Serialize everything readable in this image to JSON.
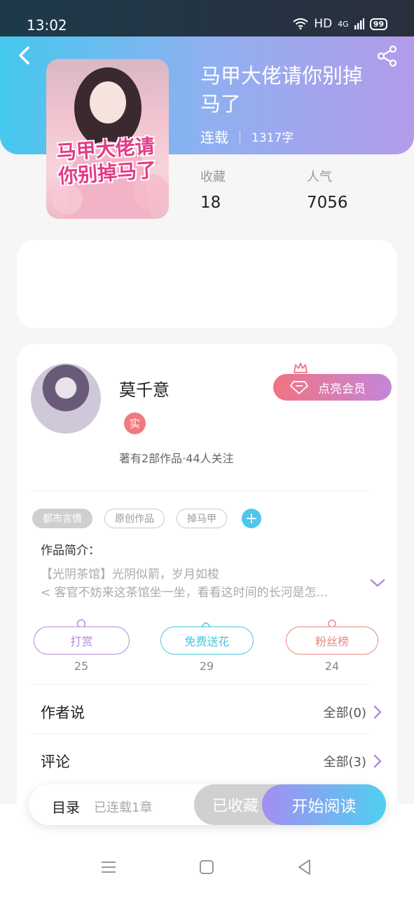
{
  "status_bar": {
    "time": "13:02",
    "network": "HD",
    "signal": "4G",
    "battery": "99"
  },
  "book": {
    "title": "马甲大佬请你别掉马了",
    "status": "连载",
    "words": "1317字",
    "cover_text": "马甲大佬请你别掉马了"
  },
  "stats": [
    {
      "label": "收藏",
      "value": "18"
    },
    {
      "label": "人气",
      "value": "7056"
    }
  ],
  "author": {
    "name": "莫千意",
    "badge": "实",
    "summary": "著有2部作品·44人关注",
    "vip_button": "点亮会员"
  },
  "tags": [
    "都市言情",
    "原创作品",
    "掉马甲"
  ],
  "add_tag": "+",
  "intro": {
    "label": "作品简介：",
    "line1": "【光阴茶馆】光阴似箭，岁月如梭",
    "line2": "< 客官不妨来这茶馆坐一坐，看看这时间的长河是怎..."
  },
  "actions": [
    {
      "label": "打赏",
      "count": "25",
      "color": "#b58ad6"
    },
    {
      "label": "免费送花",
      "count": "29",
      "color": "#46c6de"
    },
    {
      "label": "粉丝榜",
      "count": "24",
      "color": "#e88a86"
    }
  ],
  "sections": [
    {
      "title": "作者说",
      "right": "全部(0)"
    },
    {
      "title": "评论",
      "right": "全部(3)"
    }
  ],
  "bottom_bar": {
    "toc": "目录",
    "chapters": "已连载1章",
    "collected": "已收藏",
    "read": "开始阅读"
  },
  "colors": {
    "accent_blue": "#4fcff1",
    "accent_purple": "#a48ef0",
    "vip_red": "#f17382"
  }
}
